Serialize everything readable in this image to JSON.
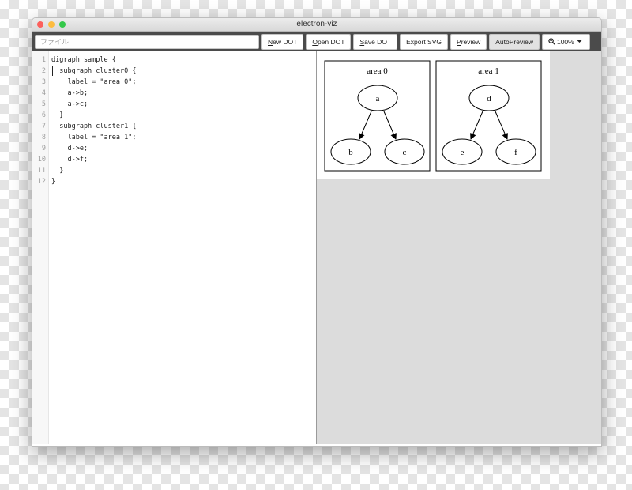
{
  "window": {
    "title": "electron-viz",
    "traffic_lights": {
      "close": "#fc605c",
      "minimize": "#fdbc40",
      "zoom": "#34c84a"
    }
  },
  "toolbar": {
    "file_input": {
      "placeholder": "ファイル",
      "value": ""
    },
    "new_dot": {
      "accel": "N",
      "rest": "ew DOT"
    },
    "open_dot": {
      "accel": "O",
      "rest": "pen DOT"
    },
    "save_dot": {
      "accel": "S",
      "rest": "ave DOT"
    },
    "export_svg": "Export SVG",
    "preview": {
      "accel": "P",
      "rest": "review"
    },
    "auto_preview": "AutoPreview",
    "zoom": {
      "icon": "zoom-in-icon",
      "value": "100%",
      "caret": "caret-down-icon"
    }
  },
  "editor": {
    "line_numbers": [
      "1",
      "2",
      "3",
      "4",
      "5",
      "6",
      "7",
      "8",
      "9",
      "10",
      "11",
      "12"
    ],
    "lines": [
      "digraph sample {",
      "  subgraph cluster0 {",
      "    label = \"area 0\";",
      "    a->b;",
      "    a->c;",
      "  }",
      "  subgraph cluster1 {",
      "    label = \"area 1\";",
      "    d->e;",
      "    d->f;",
      "  }",
      "}"
    ]
  },
  "graph": {
    "clusters": [
      {
        "label": "area 0",
        "nodes": {
          "root": "a",
          "left": "b",
          "right": "c"
        }
      },
      {
        "label": "area 1",
        "nodes": {
          "root": "d",
          "left": "e",
          "right": "f"
        }
      }
    ]
  }
}
